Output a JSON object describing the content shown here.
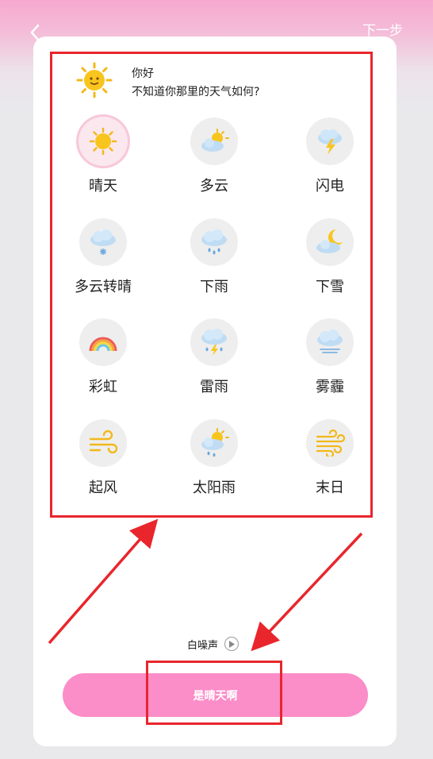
{
  "header": {
    "back_icon": "chevron-left-icon",
    "next_label": "下一步"
  },
  "greeting": {
    "icon": "sun-face-icon",
    "hello": "你好",
    "question": "不知道你那里的天气如何?"
  },
  "weather_options": [
    {
      "id": "sunny",
      "label": "晴天",
      "icon": "sun-icon",
      "selected": true
    },
    {
      "id": "cloudy",
      "label": "多云",
      "icon": "sun-cloud-icon",
      "selected": false
    },
    {
      "id": "lightning",
      "label": "闪电",
      "icon": "lightning-cloud-icon",
      "selected": false
    },
    {
      "id": "clearing",
      "label": "多云转晴",
      "icon": "snow-cloud-icon",
      "selected": false
    },
    {
      "id": "rain",
      "label": "下雨",
      "icon": "rain-cloud-icon",
      "selected": false
    },
    {
      "id": "snow",
      "label": "下雪",
      "icon": "moon-cloud-icon",
      "selected": false
    },
    {
      "id": "rainbow",
      "label": "彩虹",
      "icon": "rainbow-icon",
      "selected": false
    },
    {
      "id": "thunderstorm",
      "label": "雷雨",
      "icon": "thunderstorm-icon",
      "selected": false
    },
    {
      "id": "haze",
      "label": "雾霾",
      "icon": "fog-cloud-icon",
      "selected": false
    },
    {
      "id": "windy",
      "label": "起风",
      "icon": "wind-icon",
      "selected": false
    },
    {
      "id": "sunshower",
      "label": "太阳雨",
      "icon": "sun-rain-icon",
      "selected": false
    },
    {
      "id": "doomsday",
      "label": "末日",
      "icon": "gust-icon",
      "selected": false
    }
  ],
  "white_noise": {
    "label": "白噪声",
    "icon": "play-icon"
  },
  "confirm": {
    "label": "是晴天啊"
  },
  "colors": {
    "accent_pink": "#fb8dc8",
    "annotation_red": "#e8262c",
    "sun_yellow": "#f7c31d",
    "cloud_blue": "#b9daf3"
  }
}
